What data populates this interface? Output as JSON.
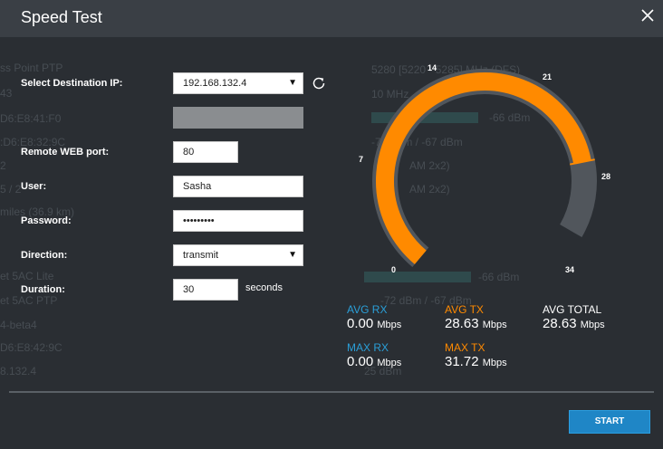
{
  "window": {
    "title": "Speed Test"
  },
  "form": {
    "destination_ip": {
      "label": "Select Destination IP:",
      "value": "192.168.132.4"
    },
    "web_port": {
      "label": "Remote WEB port:",
      "value": "80"
    },
    "user": {
      "label": "User:",
      "value": "Sasha"
    },
    "password": {
      "label": "Password:",
      "value": "•••••••••"
    },
    "direction": {
      "label": "Direction:",
      "value": "transmit"
    },
    "duration": {
      "label": "Duration:",
      "value": "30",
      "unit": "seconds"
    }
  },
  "gauge": {
    "ticks": [
      "0",
      "7",
      "14",
      "21",
      "28",
      "34"
    ],
    "max": 34,
    "value": 28.63,
    "colors": {
      "track": "#51565c",
      "fill": "#ff8a00",
      "needle": "#ff8a00"
    }
  },
  "stats": {
    "avg_rx": {
      "label": "AVG RX",
      "value": "0.00",
      "unit": "Mbps",
      "color": "#2a9fd8"
    },
    "avg_tx": {
      "label": "AVG TX",
      "value": "28.63",
      "unit": "Mbps",
      "color": "#ff8a00"
    },
    "avg_total": {
      "label": "AVG TOTAL",
      "value": "28.63",
      "unit": "Mbps",
      "color": "#ffffff"
    },
    "max_rx": {
      "label": "MAX RX",
      "value": "0.00",
      "unit": "Mbps",
      "color": "#2a9fd8"
    },
    "max_tx": {
      "label": "MAX TX",
      "value": "31.72",
      "unit": "Mbps",
      "color": "#ff8a00"
    }
  },
  "actions": {
    "start": "START"
  },
  "background": {
    "left": [
      "ss Point PTP",
      "43",
      "D6:E8:41:F0",
      ":D6:E8:32:9C",
      "2",
      "5 / 2",
      "miles (36.9 km)",
      "et 5AC Lite",
      "et 5AC PTP",
      "4-beta4",
      "D6:E8:42:9C",
      "8.132.4"
    ],
    "right": [
      "5280 [5220 - 5285] MHz (DFS)",
      "10 MHz",
      "-66 dBm",
      "-72 dBm / -67 dBm",
      "AM 2x2)",
      "AM 2x2)",
      "-66 dBm",
      "-72 dBm / -67 dBm",
      "25 dBm"
    ]
  }
}
